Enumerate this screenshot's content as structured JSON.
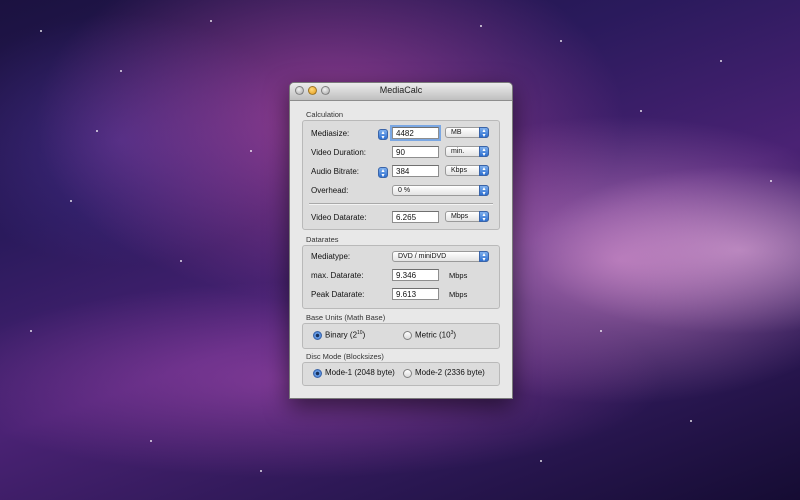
{
  "window": {
    "title": "MediaCalc"
  },
  "calculation": {
    "section_title": "Calculation",
    "mediasize": {
      "label": "Mediasize:",
      "value": "4482",
      "unit": "MB"
    },
    "video_duration": {
      "label": "Video Duration:",
      "value": "90",
      "unit": "min."
    },
    "audio_bitrate": {
      "label": "Audio Bitrate:",
      "value": "384",
      "unit": "Kbps"
    },
    "overhead": {
      "label": "Overhead:",
      "value": "0 %"
    },
    "video_datarate": {
      "label": "Video Datarate:",
      "value": "6.265",
      "unit": "Mbps"
    }
  },
  "datarates": {
    "section_title": "Datarates",
    "mediatype": {
      "label": "Mediatype:",
      "value": "DVD / miniDVD"
    },
    "max_datarate": {
      "label": "max. Datarate:",
      "value": "9.346",
      "unit": "Mbps"
    },
    "peak_datarate": {
      "label": "Peak Datarate:",
      "value": "9.613",
      "unit": "Mbps"
    }
  },
  "base_units": {
    "section_title": "Base Units (Math Base)",
    "binary": {
      "label": "Binary (2",
      "sup": "10",
      "tail": ")",
      "selected": true
    },
    "metric": {
      "label": "Metric (10",
      "sup": "3",
      "tail": ")",
      "selected": false
    }
  },
  "disc_mode": {
    "section_title": "Disc Mode (Blocksizes)",
    "mode1": {
      "label": "Mode-1 (2048 byte)",
      "selected": true
    },
    "mode2": {
      "label": "Mode-2 (2336 byte)",
      "selected": false
    }
  },
  "colors": {
    "accent": "#2f6bc9",
    "window_bg": "#e8e8e8"
  }
}
